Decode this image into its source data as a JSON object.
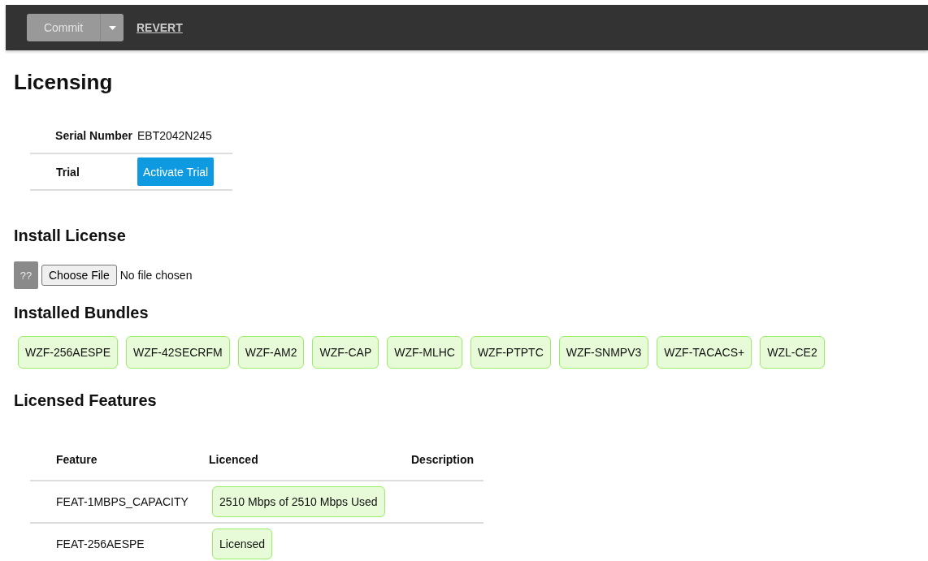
{
  "toolbar": {
    "commit": {
      "label": "Commit",
      "disabled": true
    },
    "revert": {
      "label": "REVERT"
    }
  },
  "title": "Licensing",
  "info": [
    {
      "kind": "text",
      "label": "Serial Number",
      "value": "EBT2042N245"
    },
    {
      "kind": "button",
      "label": "Trial",
      "value": "Activate Trial"
    }
  ],
  "install": {
    "title": "Install License",
    "help": "??",
    "choose": "Choose File",
    "status": "No file chosen"
  },
  "bundles": {
    "title": "Installed Bundles",
    "items": [
      "WZF-256AESPE",
      "WZF-42SECRFM",
      "WZF-AM2",
      "WZF-CAP",
      "WZF-MLHC",
      "WZF-PTPTC",
      "WZF-SNMPV3",
      "WZF-TACACS+",
      "WZL-CE2"
    ]
  },
  "features": {
    "title": "Licensed Features",
    "columns": [
      "Feature",
      "Licenced",
      "Description"
    ],
    "rows": [
      {
        "feature": "FEAT-1MBPS_CAPACITY",
        "licenced": "2510 Mbps of 2510 Mbps Used"
      },
      {
        "feature": "FEAT-256AESPE",
        "licenced": "Licensed"
      }
    ]
  }
}
